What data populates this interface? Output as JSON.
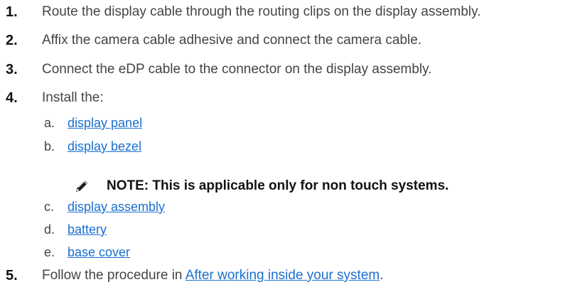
{
  "steps": [
    {
      "num": "1.",
      "text": "Route the display cable through the routing clips on the display assembly."
    },
    {
      "num": "2.",
      "text": "Affix the camera cable adhesive and connect the camera cable."
    },
    {
      "num": "3.",
      "text": "Connect the eDP cable to the connector on the display assembly."
    },
    {
      "num": "4.",
      "text": "Install the:"
    },
    {
      "num": "5.",
      "text_prefix": "Follow the procedure in ",
      "link": "After working inside your system",
      "text_suffix": "."
    }
  ],
  "install_items": [
    {
      "letter": "a.",
      "link": "display panel"
    },
    {
      "letter": "b.",
      "link": "display bezel"
    },
    {
      "letter": "c.",
      "link": "display assembly"
    },
    {
      "letter": "d.",
      "link": "battery"
    },
    {
      "letter": "e.",
      "link": "base cover"
    }
  ],
  "note": {
    "icon": "pencil-note-icon",
    "text": "NOTE: This is applicable only for non touch systems."
  },
  "colors": {
    "link": "#1a6fd0",
    "text": "#444444",
    "heading": "#111111"
  }
}
